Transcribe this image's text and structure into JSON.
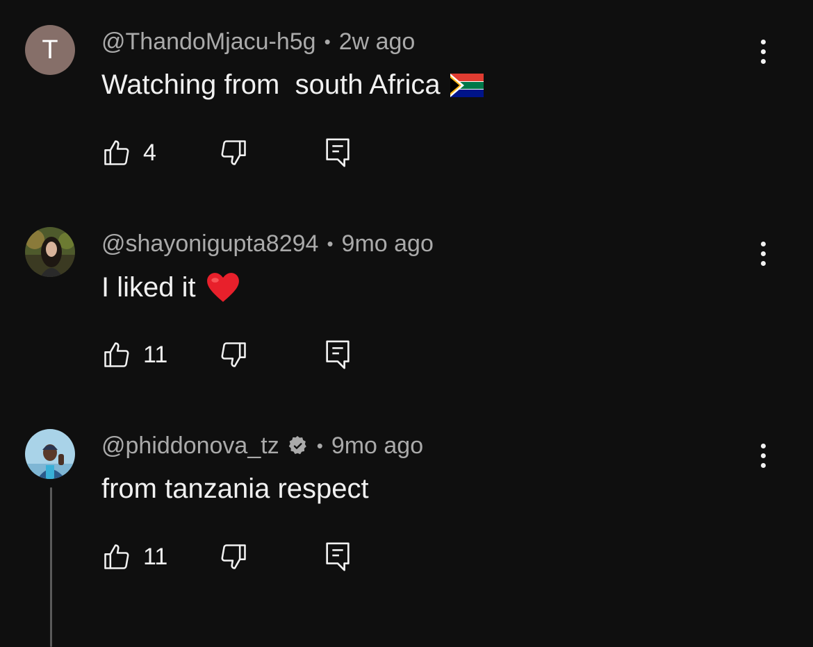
{
  "comments": [
    {
      "author": "@ThandoMjacu-h5g",
      "time": "2w ago",
      "text": "Watching from  south Africa",
      "emoji": "south-africa-flag",
      "avatar_letter": "T",
      "likes": "4"
    },
    {
      "author": "@shayonigupta8294",
      "time": "9mo ago",
      "text": "I liked it",
      "emoji": "red-heart",
      "likes": "11"
    },
    {
      "author": "@phiddonova_tz",
      "time": "9mo ago",
      "text": "from tanzania respect",
      "verified_badge": true,
      "likes": "11"
    }
  ],
  "separator": "•",
  "colors": {
    "background": "#0f0f0f",
    "text": "#f1f1f1",
    "secondary": "#aaaaaa",
    "avatar_t": "#866f69"
  },
  "icons": [
    "thumbs-up-icon",
    "thumbs-down-icon",
    "reply-icon",
    "more-vert-icon",
    "verified-badge-icon"
  ]
}
